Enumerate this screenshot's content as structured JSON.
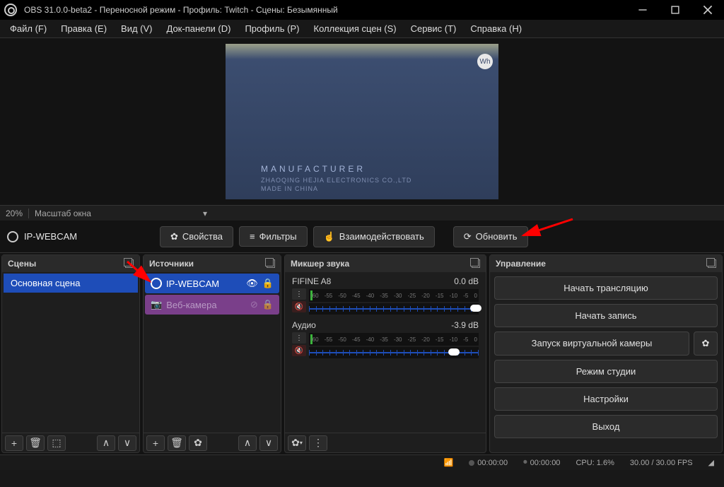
{
  "title": "OBS 31.0.0-beta2 - Переносной режим - Профиль: Twitch - Сцены: Безымянный",
  "menu": [
    "Файл (F)",
    "Правка (E)",
    "Вид (V)",
    "Док-панели (D)",
    "Профиль (P)",
    "Коллекция сцен (S)",
    "Сервис (T)",
    "Справка (H)"
  ],
  "preview": {
    "mfr": "MANUFACTURER",
    "line1": "ZHAOQING HEJIA ELECTRONICS CO.,LTD",
    "line2": "MADE IN CHINA",
    "badge": "Wh"
  },
  "zoom": {
    "value": "20%",
    "label": "Масштаб окна"
  },
  "toolbar": {
    "source_name": "IP-WEBCAM",
    "properties": "Свойства",
    "filters": "Фильтры",
    "interact": "Взаимодействовать",
    "refresh": "Обновить"
  },
  "panels": {
    "scenes": {
      "title": "Сцены",
      "items": [
        "Основная сцена"
      ]
    },
    "sources": {
      "title": "Источники",
      "items": [
        {
          "name": "IP-WEBCAM",
          "selected": true
        },
        {
          "name": "Веб-камера",
          "type": "webcam"
        }
      ]
    },
    "mixer": {
      "title": "Микшер звука",
      "scale": [
        "-60",
        "-55",
        "-50",
        "-45",
        "-40",
        "-35",
        "-30",
        "-25",
        "-20",
        "-15",
        "-10",
        "-5",
        "0"
      ],
      "items": [
        {
          "name": "FIFINE A8",
          "db": "0.0 dB",
          "pos": 95
        },
        {
          "name": "Аудио",
          "db": "-3.9 dB",
          "pos": 82
        }
      ]
    },
    "controls": {
      "title": "Управление",
      "buttons": {
        "stream": "Начать трансляцию",
        "record": "Начать запись",
        "vcam": "Запуск виртуальной камеры",
        "studio": "Режим студии",
        "settings": "Настройки",
        "exit": "Выход"
      }
    }
  },
  "status": {
    "time1": "00:00:00",
    "time2": "00:00:00",
    "cpu": "CPU: 1.6%",
    "fps": "30.00 / 30.00 FPS"
  }
}
